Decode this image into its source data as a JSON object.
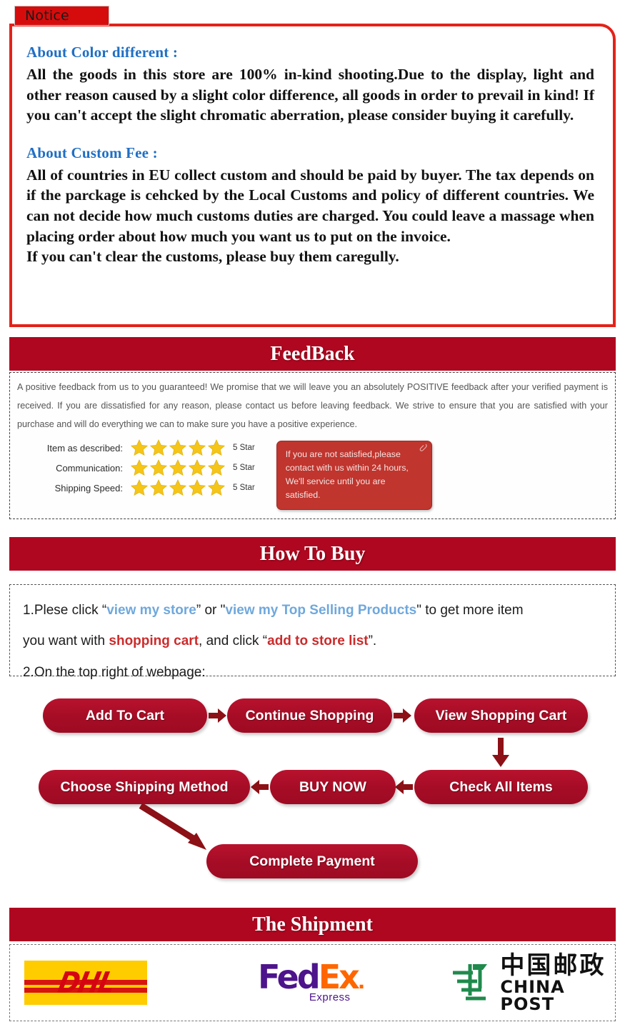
{
  "notice": {
    "tab_label": "Notice",
    "sections": [
      {
        "heading": "About Color different :",
        "body": "All the goods in this store are 100% in-kind shooting.Due to the display, light and other reason caused by a slight color difference, all goods in order to prevail in kind! If you can't accept the slight chromatic aberration, please consider buying it carefully."
      },
      {
        "heading": "About Custom Fee :",
        "body": "All of countries in EU collect custom and should be paid by buyer.  The tax depends on if the parckage is cehcked by the Local Customs and policy of different countries. We can not decide how much customs duties are charged. You could leave a massage when placing order about how much you want us to put on the invoice.",
        "body2": "If you can't clear the customs, please buy them caregully."
      }
    ]
  },
  "feedback": {
    "banner_title": "FeedBack",
    "paragraph": "A positive feedback from us to you guaranteed! We promise that we will leave you an absolutely POSITIVE feedback after your verified payment is received. If you are dissatisfied for any reason, please contact us before leaving feedback. We strive to ensure that you are satisfied with your purchase and will do everything we can to make sure you have a positive experience.",
    "ratings": [
      {
        "label": "Item as described:",
        "stars": 5,
        "value": "5 Star"
      },
      {
        "label": "Communication:",
        "stars": 5,
        "value": "5 Star"
      },
      {
        "label": "Shipping Speed:",
        "stars": 5,
        "value": "5 Star"
      }
    ],
    "note_card": "If you are not satisfied,please contact with us within 24 hours, We'll service until you are satisfied.",
    "star_color": "#f5c518"
  },
  "how_to_buy": {
    "banner_title": "How To Buy",
    "step1_a": "1.Plese click “",
    "step1_link1": "view my store",
    "step1_b": "” or \"",
    "step1_link2": "view my Top Selling Products",
    "step1_c": "\" to get more item",
    "step2_a": "you want with ",
    "step2_link1": "shopping cart",
    "step2_b": ", and click “",
    "step2_link2": "add to store list",
    "step2_c": "”.",
    "step3": "2.On the top right of webpage:",
    "flow": [
      {
        "label": "Add To Cart"
      },
      {
        "label": "Continue Shopping"
      },
      {
        "label": "View Shopping Cart"
      },
      {
        "label": "Check All Items"
      },
      {
        "label": "BUY NOW"
      },
      {
        "label": "Choose Shipping Method"
      },
      {
        "label": "Complete Payment"
      }
    ],
    "pill_color": "#b00c27"
  },
  "shipment": {
    "banner_title": "The Shipment",
    "carriers": [
      {
        "name": "dhl-logo",
        "text": "DHL"
      },
      {
        "name": "fedex-logo",
        "text_1": "Fed",
        "text_2": "Ex",
        "text_3": ".",
        "sub": "Express"
      },
      {
        "name": "china-post-logo",
        "cn": "中国邮政",
        "en": "CHINA POST"
      }
    ]
  },
  "colors": {
    "banner_red": "#b00720",
    "notice_border_red": "#e32219",
    "heading_blue": "#1f6fc4",
    "link_blue": "#6fa8dc",
    "link_red": "#cc2b2b",
    "dhl_yellow": "#ffcc00",
    "dhl_red": "#d40511",
    "fedex_purple": "#4d148c",
    "fedex_orange": "#ff6600",
    "china_post_green": "#1f8a4c"
  }
}
